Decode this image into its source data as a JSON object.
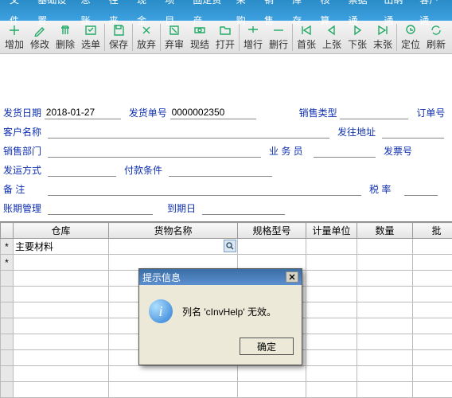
{
  "menus": [
    "文件",
    "基础设置",
    "总账",
    "往来",
    "现金",
    "项目",
    "固定资产",
    "采购",
    "销售",
    "库存",
    "核算",
    "票据通",
    "出纳通",
    "客户通"
  ],
  "toolbar": [
    {
      "name": "add",
      "label": "增加"
    },
    {
      "name": "edit",
      "label": "修改"
    },
    {
      "name": "delete",
      "label": "删除"
    },
    {
      "name": "select",
      "label": "选单"
    },
    {
      "name": "save",
      "label": "保存"
    },
    {
      "name": "abandon",
      "label": "放弃"
    },
    {
      "name": "discard",
      "label": "弃审"
    },
    {
      "name": "cash",
      "label": "现结"
    },
    {
      "name": "open",
      "label": "打开"
    },
    {
      "name": "addrow",
      "label": "增行"
    },
    {
      "name": "delrow",
      "label": "删行"
    },
    {
      "name": "first",
      "label": "首张"
    },
    {
      "name": "prev",
      "label": "上张"
    },
    {
      "name": "next",
      "label": "下张"
    },
    {
      "name": "last",
      "label": "末张"
    },
    {
      "name": "locate",
      "label": "定位"
    },
    {
      "name": "refresh",
      "label": "刷新"
    }
  ],
  "form": {
    "ship_date_label": "发货日期",
    "ship_date": "2018-01-27",
    "ship_no_label": "发货单号",
    "ship_no": "0000002350",
    "sales_type_label": "销售类型",
    "sales_type": "",
    "order_no_label": "订单号",
    "order_no": "",
    "cust_label": "客户名称",
    "cust": "",
    "ship_addr_label": "发往地址",
    "ship_addr": "",
    "sales_dept_label": "销售部门",
    "sales_dept": "",
    "clerk_label": "业 务 员",
    "clerk": "",
    "invoice_label": "发票号",
    "invoice": "",
    "ship_mode_label": "发运方式",
    "ship_mode": "",
    "pay_terms_label": "付款条件",
    "pay_terms": "",
    "remark_label": "备    注",
    "remark": "",
    "tax_label": "税  率",
    "tax": "",
    "credit_label": "账期管理",
    "credit": "",
    "due_label": "到期日",
    "due": ""
  },
  "grid": {
    "columns": [
      "",
      "仓库",
      "货物名称",
      "规格型号",
      "计量单位",
      "数量",
      "批"
    ],
    "rows": [
      {
        "warehouse": "主要材料",
        "name": "",
        "spec": "",
        "unit": "",
        "qty": "",
        "batch": ""
      }
    ],
    "empty_rows": 9
  },
  "dialog": {
    "title": "提示信息",
    "message": "列名 'cInvHelp' 无效。",
    "ok": "确定"
  }
}
